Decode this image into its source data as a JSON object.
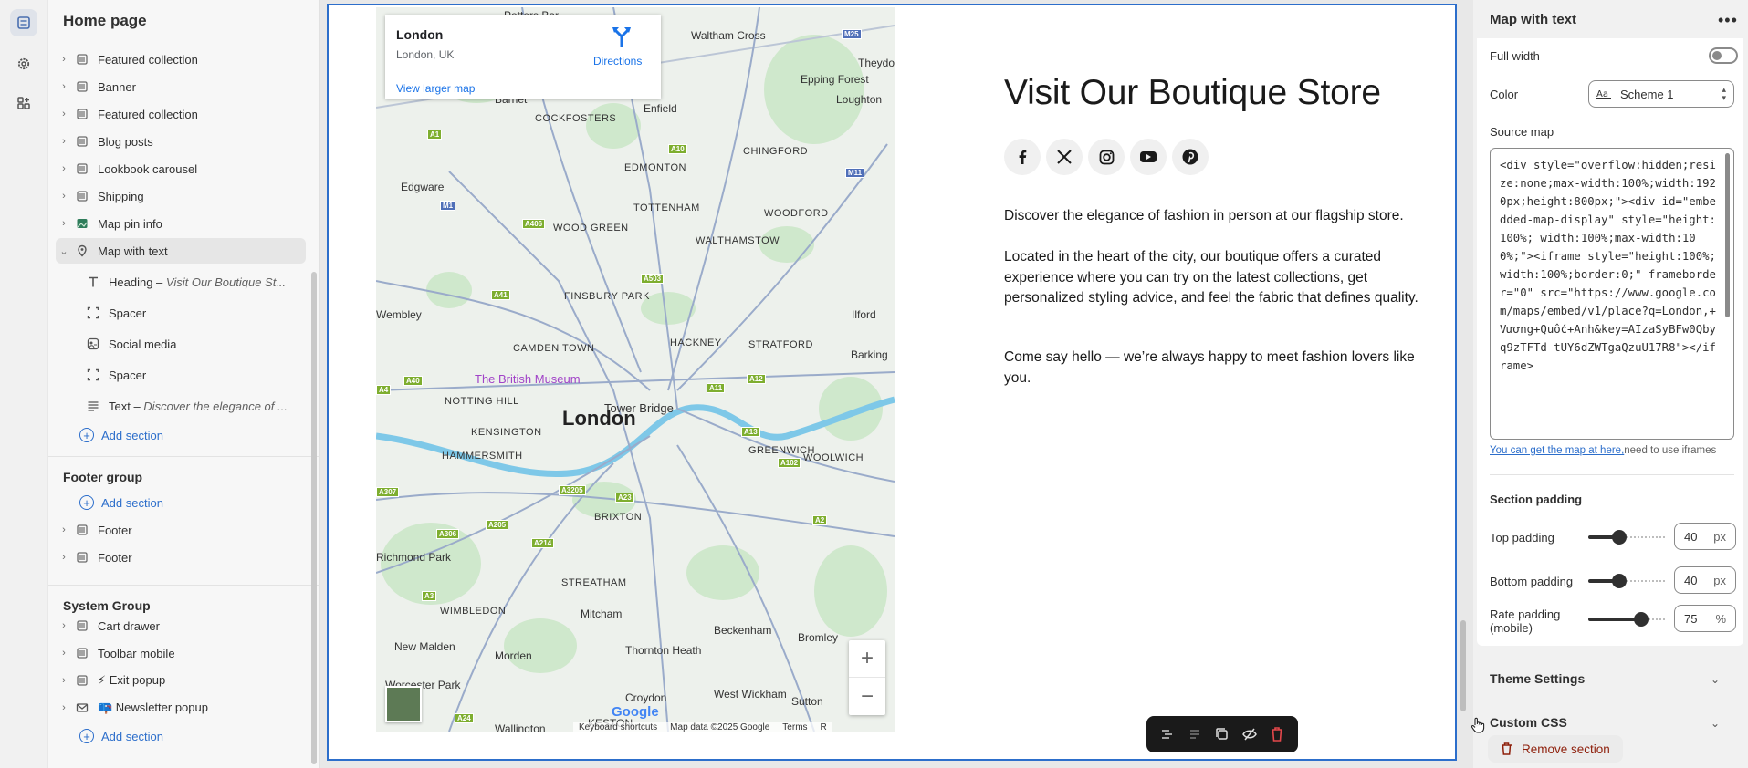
{
  "sidebar": {
    "title": "Home page",
    "sections": [
      {
        "label": "Featured collection",
        "icon": "section-icon"
      },
      {
        "label": "Banner",
        "icon": "section-icon"
      },
      {
        "label": "Featured collection",
        "icon": "section-icon"
      },
      {
        "label": "Blog posts",
        "icon": "section-icon"
      },
      {
        "label": "Lookbook carousel",
        "icon": "section-icon"
      },
      {
        "label": "Shipping",
        "icon": "section-icon"
      },
      {
        "label": "Map pin info",
        "icon": "image-icon"
      }
    ],
    "selected_section": {
      "label": "Map with text",
      "icon": "map-pin-icon"
    },
    "blocks": [
      {
        "prefix": "Heading – ",
        "detail": "Visit Our Boutique St...",
        "icon": "text-icon"
      },
      {
        "prefix": "Spacer",
        "detail": "",
        "icon": "spacer-icon"
      },
      {
        "prefix": "Social media",
        "detail": "",
        "icon": "social-icon"
      },
      {
        "prefix": "Spacer",
        "detail": "",
        "icon": "spacer-icon"
      },
      {
        "prefix": "Text – ",
        "detail": "Discover the elegance of ...",
        "icon": "paragraph-icon"
      }
    ],
    "add_section": "Add section",
    "footer_group": {
      "title": "Footer group",
      "add": "Add section",
      "items": [
        "Footer",
        "Footer"
      ]
    },
    "system_group": {
      "title": "System Group",
      "items": [
        "Cart drawer",
        "Toolbar mobile",
        "⚡ Exit popup",
        "📪 Newsletter popup"
      ],
      "add": "Add section"
    }
  },
  "map": {
    "place_name": "London",
    "place_address": "London, UK",
    "directions": "Directions",
    "larger_map": "View larger map",
    "city_label": "London",
    "poi_museum": "The British Museum",
    "poi_bridge": "Tower Bridge",
    "areas": [
      "Potters Bar",
      "Waltham Cross",
      "Epping Forest",
      "Loughton",
      "Theydon",
      "Barnet",
      "Enfield",
      "COCKFOSTERS",
      "CHINGFORD",
      "EDMONTON",
      "Edgware",
      "TOTTENHAM",
      "WOODFORD",
      "WOOD GREEN",
      "WALTHAMSTOW",
      "FINSBURY PARK",
      "Ilford",
      "Wembley",
      "CAMDEN TOWN",
      "HACKNEY",
      "STRATFORD",
      "Barking",
      "NOTTING HILL",
      "KENSINGTON",
      "HAMMERSMITH",
      "GREENWICH",
      "WOOLWICH",
      "BRIXTON",
      "Richmond Park",
      "STREATHAM",
      "WIMBLEDON",
      "New Malden",
      "Mitcham",
      "Thornton Heath",
      "Beckenham",
      "Bromley",
      "Morden",
      "Worcester Park",
      "Croydon",
      "West Wickham",
      "Sutton",
      "Wallington",
      "KESTON"
    ],
    "roads": [
      "A1",
      "M1",
      "A10",
      "M11",
      "A406",
      "A41",
      "A503",
      "M25",
      "A40",
      "A12",
      "A11",
      "A13",
      "A4",
      "A3",
      "A205",
      "A3205",
      "A23",
      "A214",
      "A306",
      "A2",
      "A102",
      "A24",
      "A307"
    ],
    "google": "Google",
    "attribution": [
      "Keyboard shortcuts",
      "Map data ©2025 Google",
      "Terms",
      "R"
    ]
  },
  "content": {
    "heading": "Visit Our Boutique Store",
    "para1": "Discover the elegance of fashion in person at our flagship store.",
    "para2": "Located in the heart of the city, our boutique offers a curated experience where you can try on the latest collections, get personalized styling advice, and feel the fabric that defines quality.",
    "para3": "Come say hello — we’re always happy to meet fashion lovers like you.",
    "socials": [
      "facebook-icon",
      "x-icon",
      "instagram-icon",
      "youtube-icon",
      "pinterest-icon"
    ]
  },
  "panel": {
    "title": "Map with text",
    "full_width_label": "Full width",
    "full_width": false,
    "color_label": "Color",
    "color_value": "Scheme 1",
    "source_map_label": "Source map",
    "source_map_value": "<div style=\"overflow:hidden;resize:none;max-width:100%;width:1920px;height:800px;\"><div id=\"embedded-map-display\" style=\"height:100%; width:100%;max-width:100%;\"><iframe style=\"height:100%;width:100%;border:0;\" frameborder=\"0\" src=\"https://www.google.com/maps/embed/v1/place?q=London,+Vương+Quốc+Anh&key=AIzaSyBFw0Qbyq9zTFTd-tUY6dZWTgaQzuU17R8\"></iframe>",
    "help_link": "You can get the map at here,",
    "help_text": "need to use iframes",
    "section_padding": "Section padding",
    "top_padding_label": "Top padding",
    "top_padding": "40",
    "bottom_padding_label": "Bottom padding",
    "bottom_padding": "40",
    "rate_padding_label": "Rate padding (mobile)",
    "rate_padding": "75",
    "unit_px": "px",
    "unit_pct": "%",
    "theme_settings": "Theme Settings",
    "custom_css": "Custom CSS",
    "remove_section": "Remove section"
  }
}
